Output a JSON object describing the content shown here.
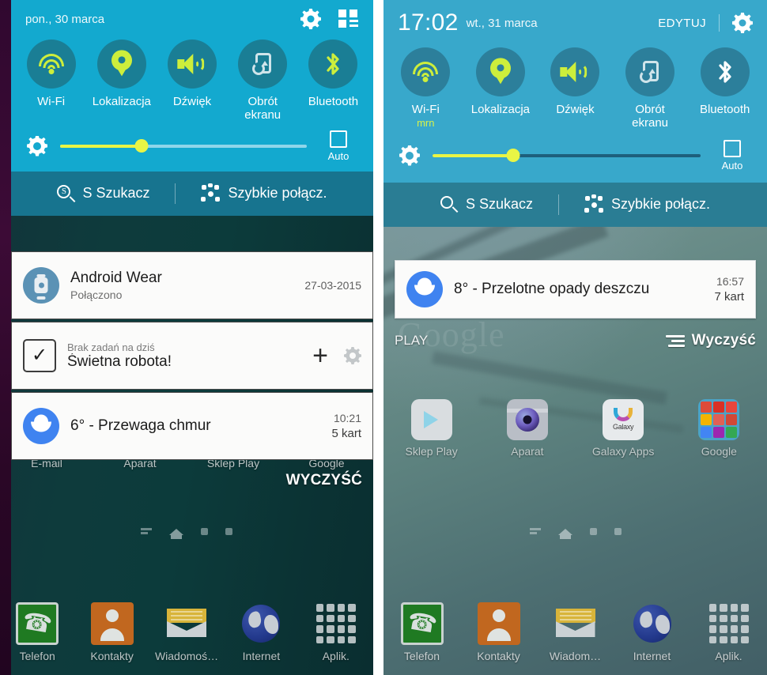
{
  "left_panel": {
    "status": {
      "date": "pon., 30 marca",
      "settings_icon": "gear-icon",
      "reorder_icon": "quick-settings-reorder-icon"
    },
    "toggles": [
      {
        "label": "Wi-Fi",
        "icon": "wifi-icon",
        "state": "on"
      },
      {
        "label": "Lokalizacja",
        "icon": "location-pin-icon",
        "state": "on"
      },
      {
        "label": "Dźwięk",
        "icon": "sound-speaker-icon",
        "state": "on"
      },
      {
        "label": "Obrót\nekranu",
        "icon": "screen-rotation-icon",
        "state": "off"
      },
      {
        "label": "Bluetooth",
        "icon": "bluetooth-icon",
        "state": "on"
      }
    ],
    "brightness": {
      "icon": "brightness-icon",
      "percent": 33,
      "auto_label": "Auto",
      "auto_checked": false
    },
    "search_bar": {
      "s_finder_label": "S Szukacz",
      "s_finder_icon": "s-finder-icon",
      "quick_connect_label": "Szybkie połącz.",
      "quick_connect_icon": "quick-connect-icon"
    },
    "notifications": [
      {
        "icon": "android-wear-watch-icon",
        "title": "Android Wear",
        "sub": "Połączono",
        "meta1": "27-03-2015",
        "meta2": ""
      },
      {
        "icon": "task-checkbox-icon",
        "presub": "Brak zadań na dziś",
        "title": "Świetna robota!",
        "actions": [
          "add-task-icon",
          "task-settings-icon"
        ]
      },
      {
        "icon": "weather-cloud-icon",
        "title": "6° - Przewaga chmur",
        "meta1": "10:21",
        "meta2": "5 kart"
      }
    ],
    "clear_button": {
      "label": "WYCZYŚĆ",
      "icon": ""
    },
    "home_apps": [
      {
        "label": "E-mail",
        "icon": "email-icon"
      },
      {
        "label": "Aparat",
        "icon": "camera-icon"
      },
      {
        "label": "Sklep Play",
        "icon": "play-store-icon"
      },
      {
        "label": "Google",
        "icon": "google-folder-icon"
      }
    ],
    "dock": [
      {
        "label": "Telefon",
        "icon": "phone-icon"
      },
      {
        "label": "Kontakty",
        "icon": "contacts-icon"
      },
      {
        "label": "Wiadomoś…",
        "icon": "messages-icon"
      },
      {
        "label": "Internet",
        "icon": "internet-globe-icon"
      },
      {
        "label": "Aplik.",
        "icon": "apps-grid-icon"
      }
    ]
  },
  "right_panel": {
    "status": {
      "time": "17:02",
      "date": "wt., 31 marca",
      "edit_label": "EDYTUJ",
      "settings_icon": "gear-icon"
    },
    "toggles": [
      {
        "label": "Wi-Fi",
        "sub": "mrn",
        "icon": "wifi-icon",
        "state": "on"
      },
      {
        "label": "Lokalizacja",
        "sub": "",
        "icon": "location-pin-icon",
        "state": "on"
      },
      {
        "label": "Dźwięk",
        "sub": "",
        "icon": "sound-speaker-icon",
        "state": "on"
      },
      {
        "label": "Obrót\nekranu",
        "sub": "",
        "icon": "screen-rotation-icon",
        "state": "off"
      },
      {
        "label": "Bluetooth",
        "sub": "",
        "icon": "bluetooth-icon",
        "state": "on"
      }
    ],
    "brightness": {
      "icon": "brightness-icon",
      "percent": 30,
      "auto_label": "Auto",
      "auto_checked": false
    },
    "search_bar": {
      "s_finder_label": "S Szukacz",
      "s_finder_icon": "search-icon",
      "quick_connect_label": "Szybkie połącz.",
      "quick_connect_icon": "quick-connect-icon"
    },
    "notifications": [
      {
        "icon": "weather-cloud-icon",
        "title": "8° - Przelotne opady deszczu",
        "meta1": "16:57",
        "meta2": "7 kart"
      }
    ],
    "carrier": "PLAY",
    "clear_button": {
      "label": "Wyczyść",
      "icon": "clear-all-icon"
    },
    "home_apps": [
      {
        "label": "Sklep Play",
        "icon": "play-store-icon"
      },
      {
        "label": "Aparat",
        "icon": "camera-icon"
      },
      {
        "label": "Galaxy Apps",
        "icon": "galaxy-apps-icon"
      },
      {
        "label": "Google",
        "icon": "google-folder-icon"
      }
    ],
    "dock": [
      {
        "label": "Telefon",
        "icon": "phone-icon"
      },
      {
        "label": "Kontakty",
        "icon": "contacts-icon"
      },
      {
        "label": "Wiadom…",
        "icon": "messages-icon"
      },
      {
        "label": "Internet",
        "icon": "internet-globe-icon"
      },
      {
        "label": "Aplik.",
        "icon": "apps-grid-icon"
      }
    ]
  },
  "colors": {
    "shade_blue_left": "#13a9cf",
    "shade_blue_right": "#38a8cb",
    "toggle_circle": "#1a7e95",
    "accent_green": "#cdee3c",
    "slider_yellow": "#e9f545",
    "search_bar_left": "#17748f",
    "search_bar_right": "#2a7d94",
    "weather_blue": "#3f83f0",
    "wear_blue": "#5b92b5"
  }
}
